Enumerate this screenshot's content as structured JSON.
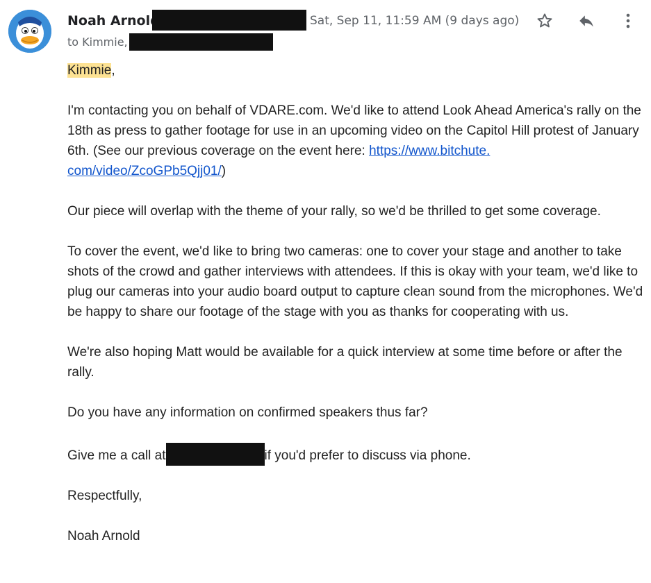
{
  "header": {
    "sender_name": "Noah Arnold",
    "date": "Sat, Sep 11, 11:59 AM (9 days ago)",
    "recipient_line": "to Kimmie,",
    "star_icon": "star-outline-icon",
    "reply_icon": "reply-icon",
    "more_icon": "more-vertical-icon"
  },
  "email": {
    "greeting_name": "Kimmie",
    "greeting_punct": ",",
    "p1_text": "I'm contacting you on behalf of VDARE.com. We'd like to attend Look Ahead America's rally on the 18th as press to gather footage for use in an upcoming video on the Capitol Hill protest of January 6th. (See our previous coverage on the event here: ",
    "p1_link_line1": "https://www.bitchute.",
    "p1_link_line2": "com/video/ZcoGPb5Qjj01/",
    "p1_close": ")",
    "p2": "Our piece will overlap with the theme of your rally, so we'd be thrilled to get some coverage.",
    "p3": "To cover the event, we'd like to bring two cameras: one to cover your stage and another to take shots of the crowd and gather interviews with attendees. If this is okay with your team, we'd like to plug our cameras into your audio board output to capture clean sound from the microphones. We'd be happy to share our footage of the stage with you as thanks for cooperating with us.",
    "p4": "We're also hoping Matt would be available for a quick interview at some time before or after the rally.",
    "p5": "Do you have any information on confirmed speakers thus far?",
    "p6_before": "Give me a call at",
    "p6_after": "if you'd prefer to discuss via phone.",
    "closing": "Respectfully,",
    "signature": "Noah Arnold"
  },
  "colors": {
    "highlight": "#fde293",
    "link": "#1155cc",
    "redaction": "#111111",
    "avatar_bg": "#3b8fd9"
  }
}
